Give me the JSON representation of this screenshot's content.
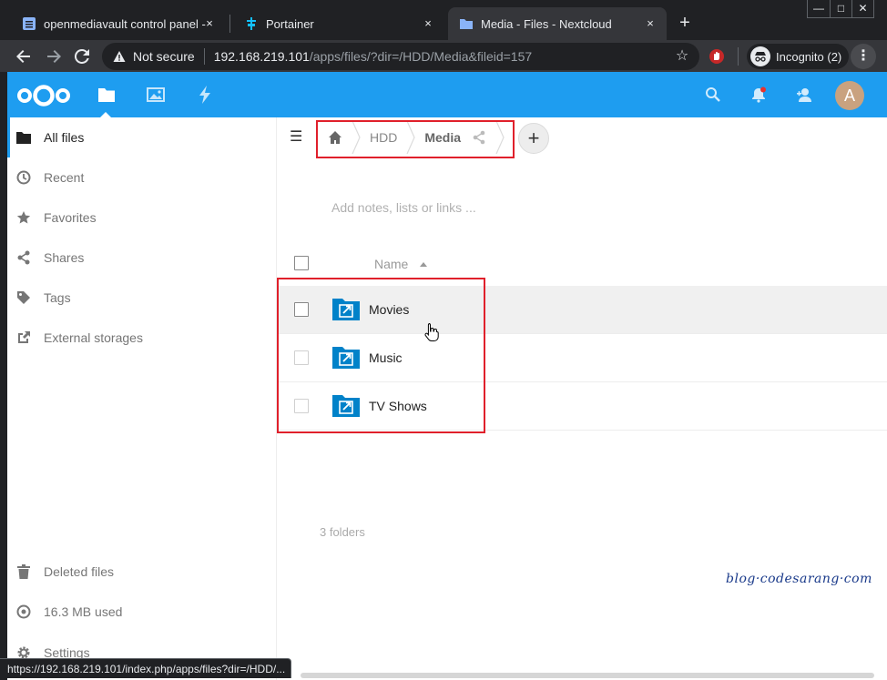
{
  "browser": {
    "tabs": [
      {
        "title": "openmediavault control panel - ",
        "close": "×"
      },
      {
        "title": "Portainer",
        "close": "×"
      },
      {
        "title": "Media - Files - Nextcloud",
        "close": "×"
      }
    ],
    "new_tab": "+",
    "window_controls": [
      "—",
      "□",
      "✕"
    ],
    "not_secure": "Not secure",
    "url_host": "192.168.219.101",
    "url_path": "/apps/files/?dir=/HDD/Media&fileid=157",
    "incognito_label": "Incognito (2)",
    "status_url": "https://192.168.219.101/index.php/apps/files?dir=/HDD/..."
  },
  "nextcloud": {
    "user_initial": "A",
    "sidebar": {
      "items": [
        {
          "label": "All files",
          "icon": "folder-icon"
        },
        {
          "label": "Recent",
          "icon": "clock-icon"
        },
        {
          "label": "Favorites",
          "icon": "star-icon"
        },
        {
          "label": "Shares",
          "icon": "share-icon"
        },
        {
          "label": "Tags",
          "icon": "tag-icon"
        },
        {
          "label": "External storages",
          "icon": "external-link-icon"
        }
      ],
      "bottom": [
        {
          "label": "Deleted files",
          "icon": "trash-icon"
        },
        {
          "label": "16.3 MB used",
          "icon": "pie-icon"
        },
        {
          "label": "Settings",
          "icon": "gear-icon"
        }
      ]
    },
    "breadcrumb": {
      "home": "home-icon",
      "items": [
        "HDD",
        "Media"
      ]
    },
    "add_button": "+",
    "notes_placeholder": "Add notes, lists or links ...",
    "list": {
      "column_name": "Name",
      "rows": [
        "Movies",
        "Music",
        "TV Shows"
      ],
      "summary": "3 folders"
    },
    "watermark": "blog·codesarang·com",
    "colors": {
      "header": "#1e9df0",
      "folder": "#0082c9",
      "highlight": "#e0202b"
    }
  }
}
